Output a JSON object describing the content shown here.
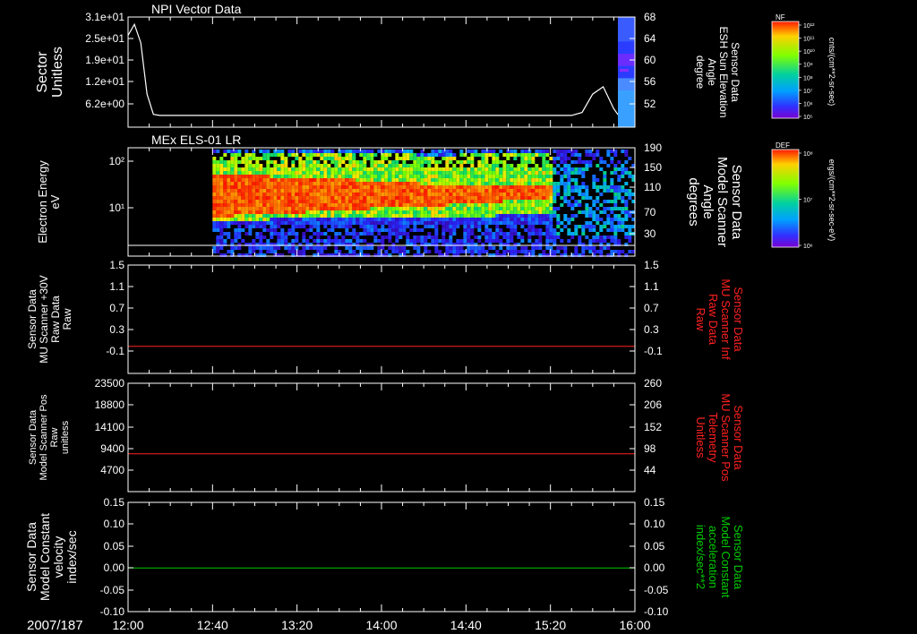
{
  "date_label": "2007/187",
  "time_axis": {
    "ticks": [
      "12:00",
      "12:40",
      "13:20",
      "14:00",
      "14:40",
      "15:20",
      "16:00"
    ]
  },
  "colors": {
    "line_white": "#ffffff",
    "line_red": "#ff2020",
    "line_green": "#00cc00",
    "spectrogram_background": "#000000"
  },
  "colorbars": [
    {
      "id": "nf",
      "label": "NF",
      "tick_labels": [
        "10¹²",
        "10¹¹",
        "10¹⁰",
        "10⁹",
        "10⁸",
        "10⁷",
        "10⁶",
        "10⁵"
      ],
      "units": "cnts/(cm**2-sr-sec)"
    },
    {
      "id": "def",
      "label": "DEF",
      "tick_labels": [
        "10⁸",
        "10⁷",
        "10⁶"
      ],
      "units": "ergs/(cm**2-sr-sec-eV)"
    }
  ],
  "chart_data": [
    {
      "type": "line",
      "title": "NPI Vector Data",
      "ylabel": [
        "Sector",
        "Unitless"
      ],
      "y_ticks": [
        "3.1e+01",
        "2.5e+01",
        "1.9e+01",
        "1.2e+01",
        "6.2e+00"
      ],
      "ylim": [
        3,
        33
      ],
      "right_ylabel": [
        "Sensor Data",
        "ESH Sun Elevation",
        "Angle",
        "degree"
      ],
      "right_y_ticks": [
        "68",
        "64",
        "60",
        "56",
        "52"
      ],
      "right_ylim": [
        48,
        68
      ],
      "series": [
        {
          "color": "#ffffff",
          "x": [
            "12:00",
            "12:03",
            "12:06",
            "12:09",
            "12:12",
            "12:15",
            "12:20",
            "15:30",
            "15:35",
            "15:40",
            "15:45",
            "15:50",
            "15:55",
            "16:00"
          ],
          "values": [
            28,
            31,
            26,
            12,
            6.5,
            6.2,
            6.2,
            6.2,
            7,
            12,
            14,
            8,
            4,
            4
          ]
        }
      ],
      "strip": {
        "side": "right",
        "variable": "ESH Sun Elevation Angle",
        "colors": [
          "#3a5cff",
          "#3a5cff",
          "#2b3cff",
          "#6a2cff",
          "#2b3cff",
          "#4a8cff",
          "#3aa0ff",
          "#3aa0ff",
          "#3aa0ff"
        ]
      }
    },
    {
      "type": "heatmap",
      "title": "MEx ELS-01 LR",
      "ylabel": [
        "Electron Energy",
        "eV"
      ],
      "y_ticks": [
        "10²",
        "10¹"
      ],
      "yscale": "log",
      "right_ylabel": [
        "Sensor Data",
        "Model Scanner",
        "Angle",
        "degrees"
      ],
      "right_y_ticks": [
        "190",
        "150",
        "110",
        "70",
        "30"
      ],
      "data_start": "12:40",
      "core_end": "15:20",
      "horizontal_line_y": "lower boundary (white)"
    },
    {
      "type": "line",
      "ylabel": [
        "Sensor Data",
        "MU Scanner +30V",
        "Raw Data",
        "Raw"
      ],
      "y_ticks": [
        "1.5",
        "1.1",
        "0.7",
        "0.3",
        "-0.1"
      ],
      "ylim": [
        -0.5,
        1.5
      ],
      "right_ylabel": [
        "Sensor Data",
        "MU Scanner Inf",
        "Raw Data",
        "Raw"
      ],
      "right_ylabel_color": "#ff2020",
      "right_y_ticks": [
        "1.5",
        "1.1",
        "0.7",
        "0.3",
        "-0.1"
      ],
      "series": [
        {
          "color": "#ff2020",
          "constant": 0.0
        }
      ]
    },
    {
      "type": "line",
      "ylabel": [
        "Sensor Data",
        "Model Scanner Pos",
        "Raw",
        "unitless"
      ],
      "y_ticks": [
        "23500",
        "18800",
        "14100",
        "9400",
        "4700"
      ],
      "ylim": [
        0,
        23500
      ],
      "right_ylabel": [
        "Sensor Data",
        "MU Scanner Pos",
        "Telemetry",
        "Unitless"
      ],
      "right_ylabel_color": "#ff2020",
      "right_y_ticks": [
        "260",
        "206",
        "152",
        "98",
        "44"
      ],
      "series": [
        {
          "color": "#ff2020",
          "constant": 8200
        }
      ]
    },
    {
      "type": "line",
      "ylabel": [
        "Sensor Data",
        "Model Constant",
        "velocity",
        "index/sec"
      ],
      "y_ticks": [
        "0.15",
        "0.10",
        "0.05",
        "0.00",
        "-0.05",
        "-0.10"
      ],
      "ylim": [
        -0.1,
        0.15
      ],
      "right_ylabel": [
        "Sensor Data",
        "Model Constant",
        "acceleration",
        "index/sec**2"
      ],
      "right_ylabel_color": "#00cc00",
      "right_y_ticks": [
        "0.15",
        "0.10",
        "0.05",
        "0.00",
        "-0.05",
        "-0.10"
      ],
      "series": [
        {
          "color": "#00cc00",
          "constant": 0.0
        }
      ]
    }
  ]
}
